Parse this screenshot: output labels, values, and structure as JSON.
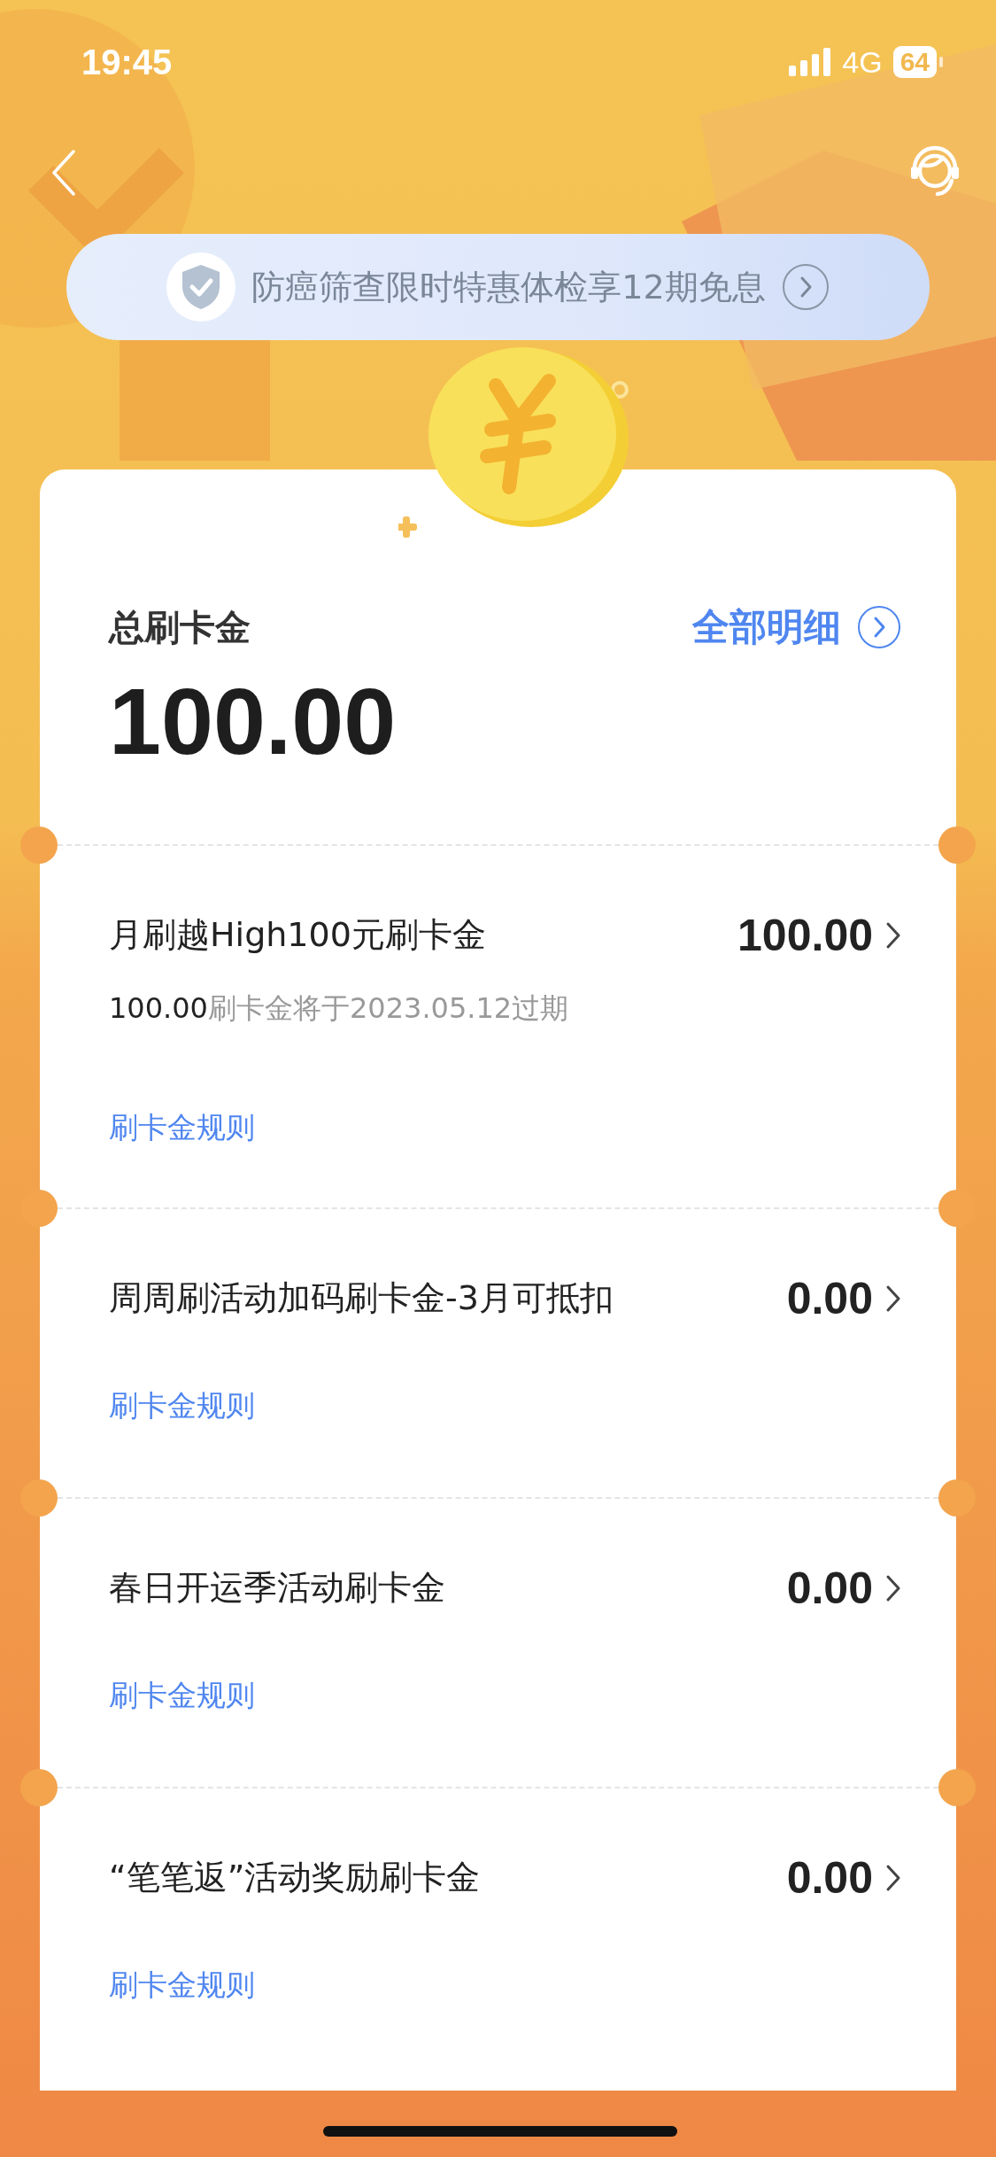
{
  "status_bar": {
    "time": "19:45",
    "network": "4G",
    "battery": "64"
  },
  "banner": {
    "text": "防癌筛查限时特惠体检享12期免息"
  },
  "summary": {
    "label": "总刷卡金",
    "amount": "100.00",
    "detail_link": "全部明细"
  },
  "items": [
    {
      "title": "月刷越High100元刷卡金",
      "amount": "100.00",
      "expiry": {
        "amount": "100.00",
        "text": "刷卡金将于2023.05.12过期"
      },
      "rule_link": "刷卡金规则"
    },
    {
      "title": "周周刷活动加码刷卡金-3月可抵扣",
      "amount": "0.00",
      "rule_link": "刷卡金规则"
    },
    {
      "title": "春日开运季活动刷卡金",
      "amount": "0.00",
      "rule_link": "刷卡金规则"
    },
    {
      "title": "“笔笔返”活动奖励刷卡金",
      "amount": "0.00",
      "rule_link": "刷卡金规则"
    }
  ]
}
